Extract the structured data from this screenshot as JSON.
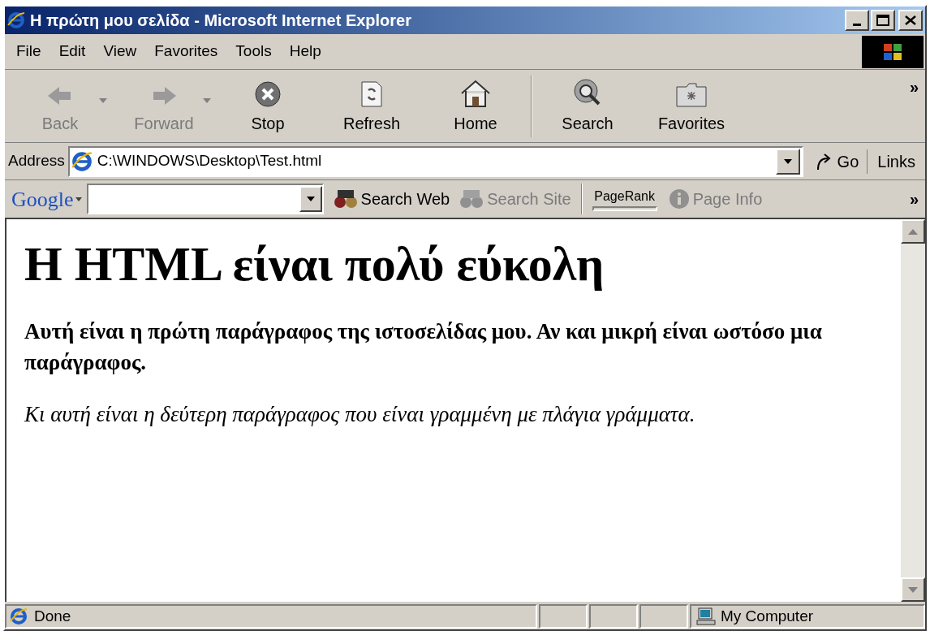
{
  "window": {
    "title": "Η πρώτη μου σελίδα - Microsoft Internet Explorer"
  },
  "menu": [
    "File",
    "Edit",
    "View",
    "Favorites",
    "Tools",
    "Help"
  ],
  "toolbar": {
    "buttons": [
      {
        "label": "Back",
        "disabled": true,
        "dropdown": true
      },
      {
        "label": "Forward",
        "disabled": true,
        "dropdown": true
      },
      {
        "label": "Stop",
        "disabled": false,
        "dropdown": false
      },
      {
        "label": "Refresh",
        "disabled": false,
        "dropdown": false
      },
      {
        "label": "Home",
        "disabled": false,
        "dropdown": false
      },
      {
        "label": "Search",
        "disabled": false,
        "dropdown": false
      },
      {
        "label": "Favorites",
        "disabled": false,
        "dropdown": false
      }
    ],
    "more": "»"
  },
  "address_bar": {
    "label": "Address",
    "value": "C:\\WINDOWS\\Desktop\\Test.html",
    "go": "Go",
    "links": "Links"
  },
  "google_bar": {
    "logo": "Google",
    "buttons": [
      {
        "label": "Search Web",
        "disabled": false
      },
      {
        "label": "Search Site",
        "disabled": true
      }
    ],
    "pagerank": "PageRank",
    "page_info": {
      "label": "Page Info",
      "disabled": true
    },
    "more": "»"
  },
  "page": {
    "heading": "Η HTML είναι πολύ εύκολη",
    "paragraphs": [
      {
        "text": "Αυτή είναι η πρώτη παράγραφος της ιστοσελίδας μου. Αν και μικρή είναι ωστόσο μια παράγραφος.",
        "kind": "bold"
      },
      {
        "text": "Κι αυτή είναι η δεύτερη παράγραφος που είναι γραμμένη με πλάγια γράμματα.",
        "kind": "italic"
      }
    ]
  },
  "status_bar": {
    "text": "Done",
    "zone": "My Computer"
  }
}
